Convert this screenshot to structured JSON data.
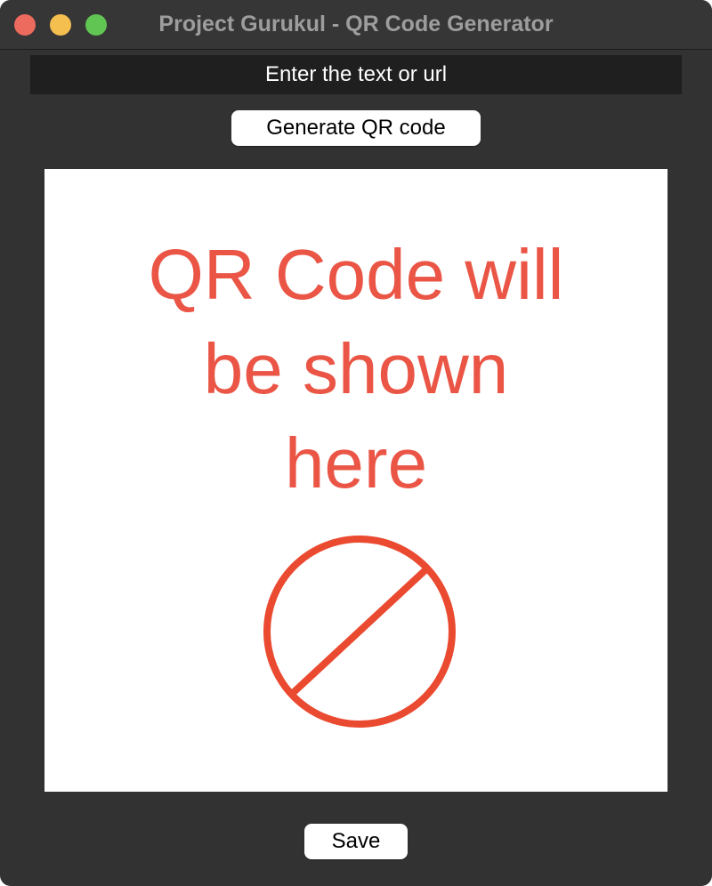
{
  "window": {
    "title": "Project Gurukul - QR Code Generator"
  },
  "input": {
    "value": "",
    "placeholder": "Enter the text or url"
  },
  "buttons": {
    "generate_label": "Generate QR code",
    "save_label": "Save"
  },
  "qr_panel": {
    "placeholder_text": "QR Code will\nbe shown\nhere",
    "icon": "no-entry-icon",
    "accent_color": "#ea4a30"
  }
}
